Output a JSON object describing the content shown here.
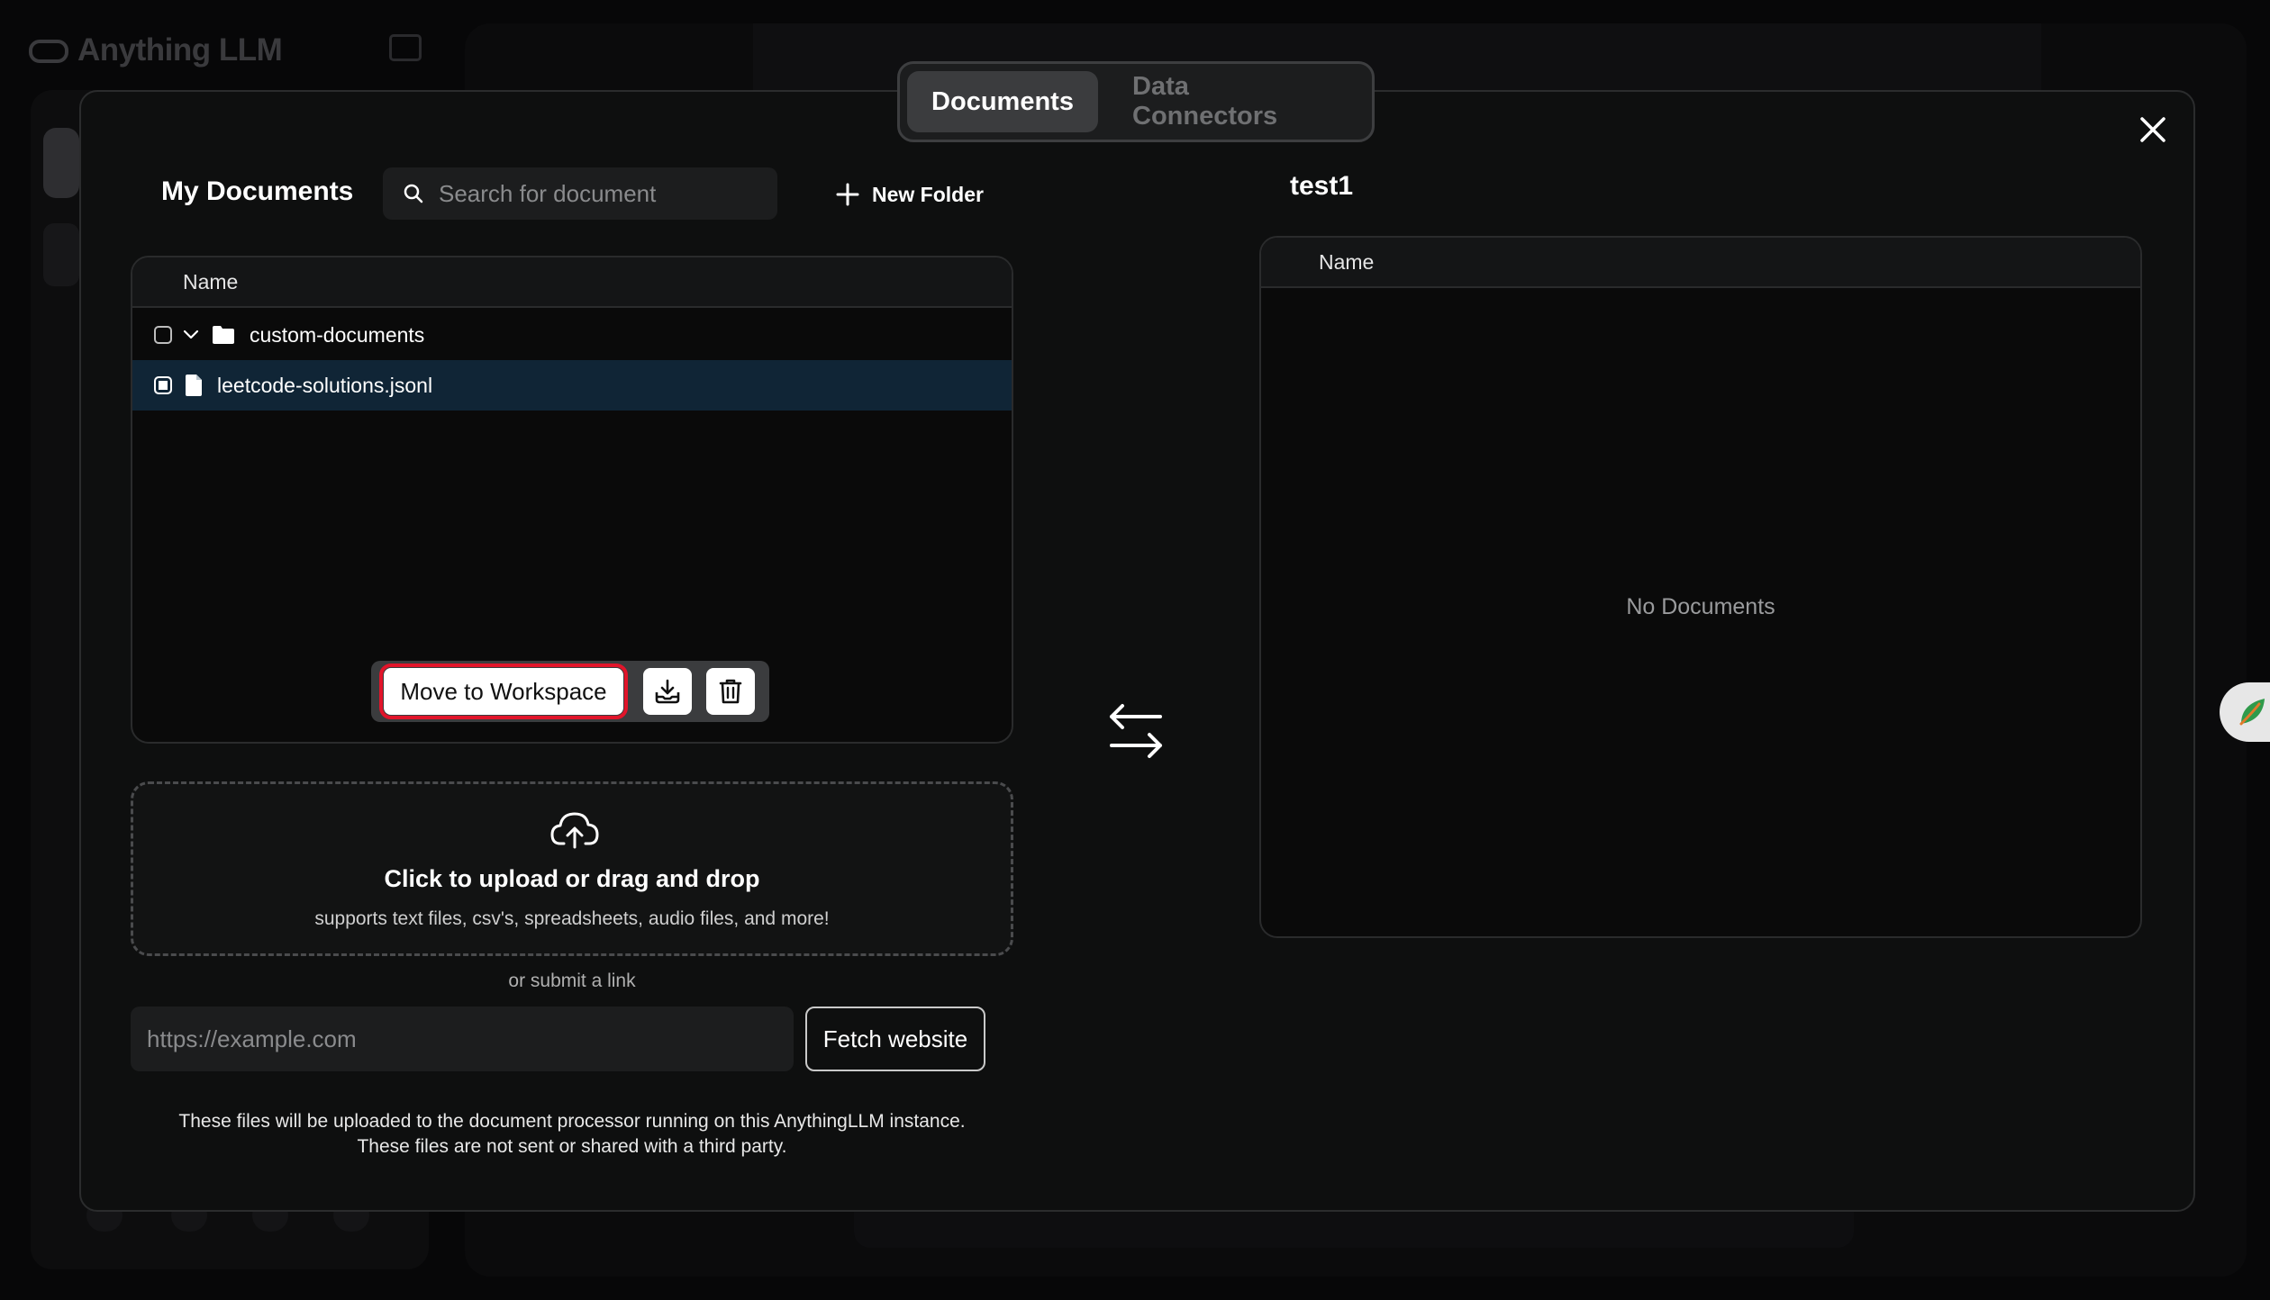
{
  "background_app": {
    "logo_text": "Anything LLM"
  },
  "modal": {
    "tabs": [
      {
        "label": "Documents",
        "active": true
      },
      {
        "label": "Data Connectors",
        "active": false
      }
    ],
    "close_icon": "close-icon",
    "my_documents": {
      "title": "My Documents",
      "search_placeholder": "Search for document",
      "new_folder_label": "New Folder",
      "table_header_name": "Name",
      "rows": [
        {
          "type": "folder",
          "name": "custom-documents",
          "checked": false,
          "expanded": true,
          "icon": "folder-icon"
        },
        {
          "type": "file",
          "name": "leetcode-solutions.jsonl",
          "checked": true,
          "selected": true,
          "icon": "file-icon"
        }
      ],
      "actions": {
        "move_label": "Move to Workspace",
        "icons": [
          "download-tray-icon",
          "trash-icon"
        ]
      }
    },
    "upload": {
      "icon": "cloud-upload-icon",
      "title": "Click to upload or drag and drop",
      "subtitle": "supports text files, csv's, spreadsheets, audio files, and more!",
      "or_link_text": "or submit a link",
      "url_placeholder": "https://example.com",
      "fetch_label": "Fetch website",
      "note_line1": "These files will be uploaded to the document processor running on this AnythingLLM instance.",
      "note_line2": "These files are not sent or shared with a third party."
    },
    "swap_icon": "swap-arrows-icon",
    "workspace": {
      "title": "test1",
      "table_header_name": "Name",
      "empty_text": "No Documents"
    }
  },
  "colors": {
    "modal_bg": "#0e0f0f",
    "selected_row": "#102536",
    "highlight_outline": "#e1142a"
  }
}
